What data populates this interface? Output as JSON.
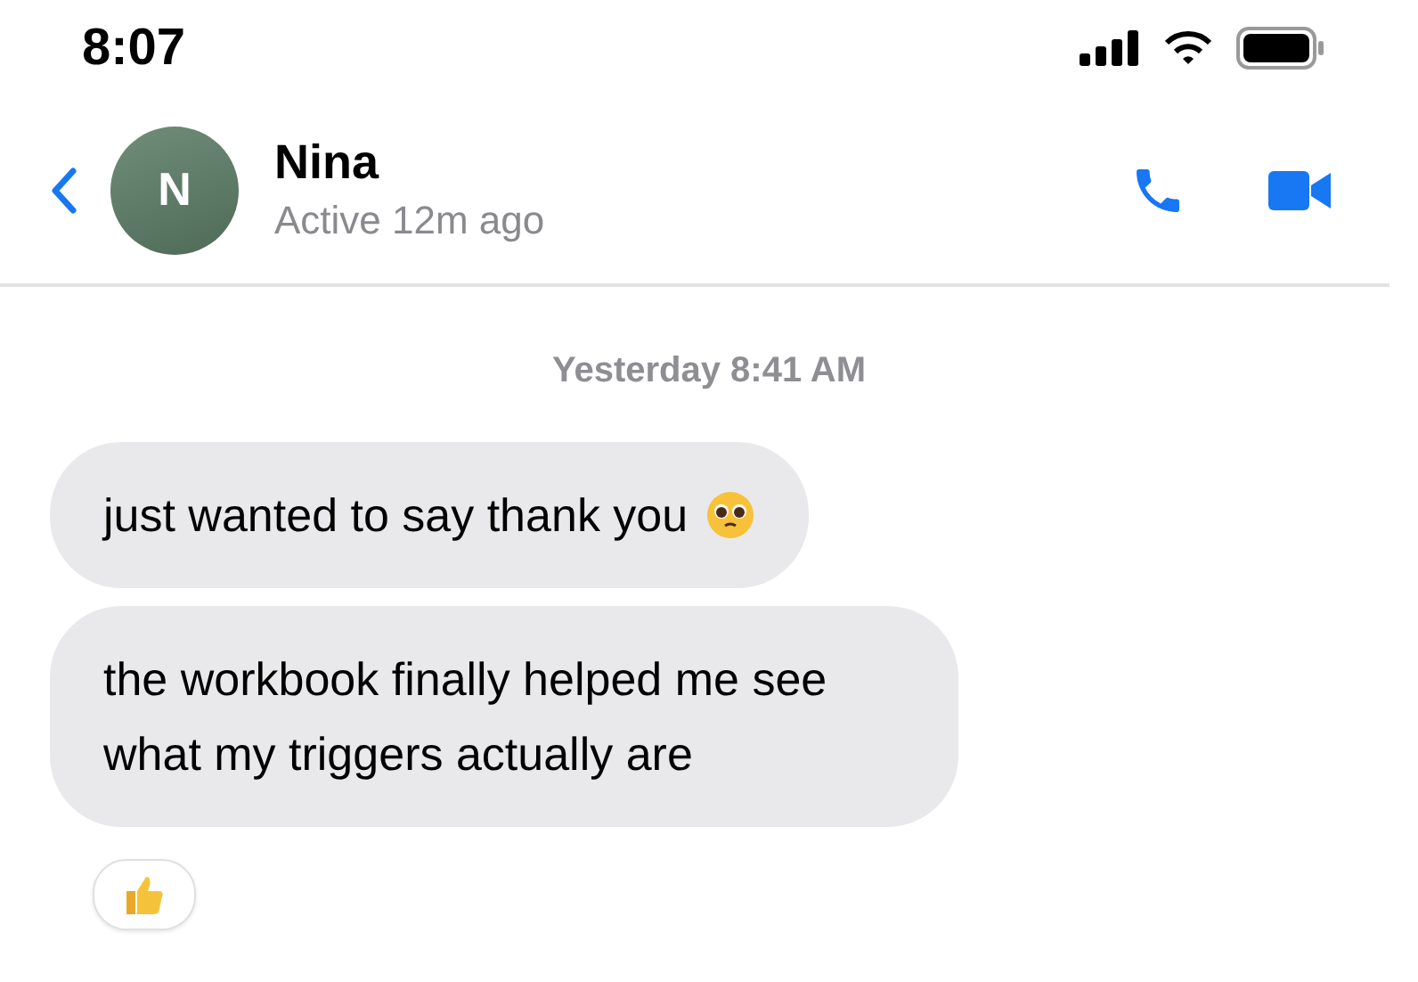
{
  "status_bar": {
    "time": "8:07"
  },
  "header": {
    "avatar_initial": "N",
    "name": "Nina",
    "status": "Active 12m ago"
  },
  "timestamp": "Yesterday 8:41 AM",
  "messages": [
    {
      "kind": "text_with_face",
      "text": "just wanted to say thank you"
    },
    {
      "kind": "text",
      "text": "the workbook finally helped me see what my triggers actually are"
    }
  ],
  "reaction": {
    "kind": "thumbs_up"
  }
}
